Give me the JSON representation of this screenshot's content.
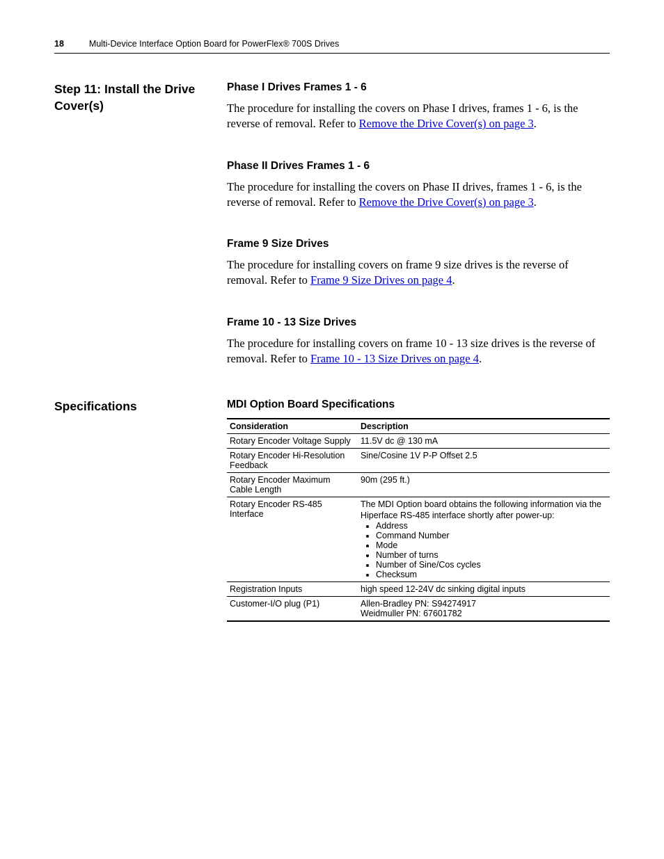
{
  "header": {
    "page_number": "18",
    "title": "Multi-Device Interface Option Board for PowerFlex® 700S Drives"
  },
  "section1": {
    "side_heading": "Step 11:  Install the Drive Cover(s)",
    "blocks": [
      {
        "heading": "Phase I Drives Frames 1 - 6",
        "pre": "The procedure for installing the covers on Phase I drives, frames 1 - 6, is the reverse of removal. Refer to ",
        "link": "Remove the Drive Cover(s) on page 3",
        "post": "."
      },
      {
        "heading": "Phase II Drives Frames 1 - 6",
        "pre": "The procedure for installing the covers on Phase II drives, frames 1 - 6, is the reverse of removal. Refer to ",
        "link": "Remove the Drive Cover(s) on page 3",
        "post": "."
      },
      {
        "heading": "Frame 9 Size Drives",
        "pre": "The procedure for installing covers on frame 9 size drives is the reverse of removal. Refer to ",
        "link": "Frame 9 Size Drives on page 4",
        "post": "."
      },
      {
        "heading": "Frame 10 - 13 Size Drives",
        "pre": "The procedure for installing covers on frame 10 - 13 size drives is the reverse of removal. Refer to ",
        "link": "Frame 10 - 13 Size Drives on page 4",
        "post": "."
      }
    ]
  },
  "section2": {
    "side_heading": "Specifications",
    "table_heading": "MDI Option Board Specifications",
    "col1": "Consideration",
    "col2": "Description",
    "rows": {
      "r0": {
        "c": "Rotary Encoder Voltage Supply",
        "d": "11.5V dc @ 130 mA"
      },
      "r1": {
        "c": "Rotary Encoder Hi-Resolution Feedback",
        "d": "Sine/Cosine 1V P-P Offset 2.5"
      },
      "r2": {
        "c": "Rotary Encoder Maximum Cable Length",
        "d": "90m (295 ft.)"
      },
      "r3": {
        "c": "Rotary Encoder RS-485 Interface",
        "intro": "The MDI Option board obtains the following information via the Hiperface RS-485 interface shortly after power-up:",
        "items": [
          "Address",
          "Command Number",
          "Mode",
          "Number of turns",
          "Number of Sine/Cos cycles",
          "Checksum"
        ]
      },
      "r4": {
        "c": "Registration Inputs",
        "d": "high speed 12-24V dc sinking digital inputs"
      },
      "r5": {
        "c": "Customer-I/O plug (P1)",
        "l1": "Allen-Bradley PN: S94274917",
        "l2": "Weidmuller PN: 67601782"
      }
    }
  }
}
